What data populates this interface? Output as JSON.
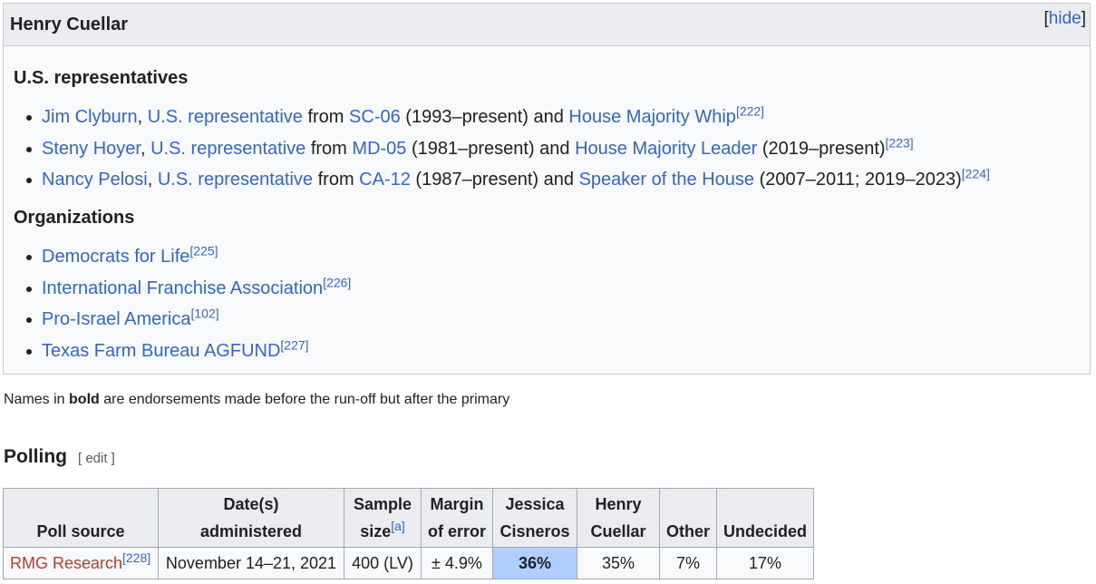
{
  "endorsements_box": {
    "title": "Henry Cuellar",
    "toggle": {
      "open": "[",
      "label": "hide",
      "close": "]"
    },
    "sections": [
      {
        "heading": "U.S. representatives",
        "items": [
          {
            "name": "Jim Clyburn",
            "sep1": ", ",
            "role": "U.S. representative",
            "from": " from ",
            "district": "SC-06",
            "tenure": " (1993–present) and ",
            "office": "House Majority Whip",
            "after": "",
            "ref": "[222]"
          },
          {
            "name": "Steny Hoyer",
            "sep1": ", ",
            "role": "U.S. representative",
            "from": " from ",
            "district": "MD-05",
            "tenure": " (1981–present) and ",
            "office": "House Majority Leader",
            "after": " (2019–present)",
            "ref": "[223]"
          },
          {
            "name": "Nancy Pelosi",
            "sep1": ", ",
            "role": "U.S. representative",
            "from": " from ",
            "district": "CA-12",
            "tenure": " (1987–present) and ",
            "office": "Speaker of the House",
            "after": " (2007–2011; 2019–2023)",
            "ref": "[224]"
          }
        ]
      },
      {
        "heading": "Organizations",
        "items": [
          {
            "name": "Democrats for Life",
            "ref": "[225]"
          },
          {
            "name": "International Franchise Association",
            "ref": "[226]"
          },
          {
            "name": "Pro-Israel America",
            "ref": "[102]"
          },
          {
            "name": "Texas Farm Bureau AGFUND",
            "ref": "[227]"
          }
        ]
      }
    ]
  },
  "note": {
    "before": "Names in ",
    "bold": "bold",
    "after": " are endorsements made before the run-off but after the primary"
  },
  "polling": {
    "heading": "Polling",
    "edit": "[ edit ]",
    "headers": {
      "poll_source": "Poll source",
      "date_line1": "Date(s)",
      "date_line2": "administered",
      "sample_line1": "Sample",
      "sample_line2": "size",
      "sample_ref": "[a]",
      "margin_line1": "Margin",
      "margin_line2": "of error",
      "cand1_line1": "Jessica",
      "cand1_line2": "Cisneros",
      "cand2_line1": "Henry",
      "cand2_line2": "Cuellar",
      "other": "Other",
      "undecided": "Undecided"
    },
    "rows": [
      {
        "source": "RMG Research",
        "source_ref": "[228]",
        "date": "November 14–21, 2021",
        "sample": "400 (LV)",
        "margin": "± 4.9%",
        "cisneros": "36%",
        "cuellar": "35%",
        "other": "7%",
        "undecided": "17%"
      }
    ],
    "leader_color": "#b0ceff"
  }
}
